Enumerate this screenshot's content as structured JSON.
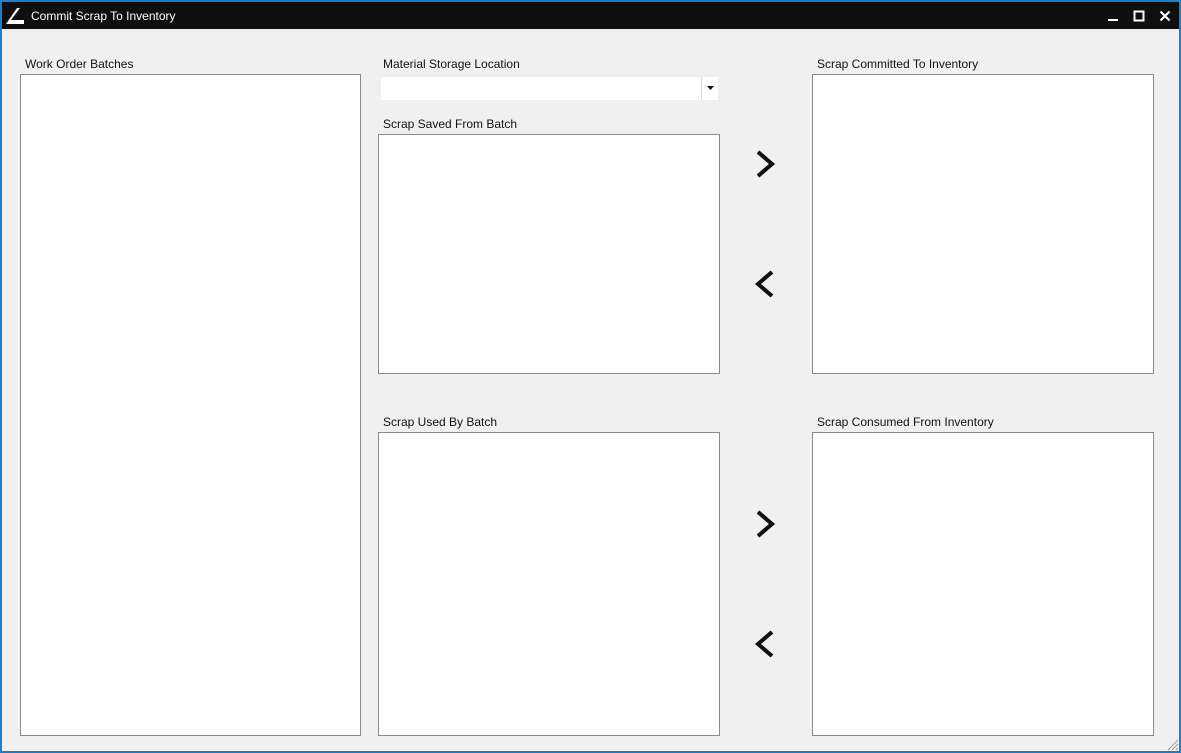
{
  "window": {
    "title": "Commit Scrap To Inventory",
    "accent_color": "#1e7fc9",
    "titlebar_color": "#0f0f0f",
    "controls": [
      "minimize-icon",
      "maximize-icon",
      "close-icon"
    ]
  },
  "panels": {
    "work_order_batches": {
      "label": "Work Order Batches",
      "items": []
    },
    "material_storage_location": {
      "label": "Material Storage Location",
      "selected": ""
    },
    "scrap_saved_from_batch": {
      "label": "Scrap Saved From Batch",
      "items": []
    },
    "scrap_committed_to_inventory": {
      "label": "Scrap Committed To Inventory",
      "items": []
    },
    "scrap_used_by_batch": {
      "label": "Scrap Used By Batch",
      "items": []
    },
    "scrap_consumed_from_inventory": {
      "label": "Scrap Consumed From Inventory",
      "items": []
    }
  },
  "buttons": {
    "commit_right": "chevron-right-icon",
    "commit_left": "chevron-left-icon",
    "consume_right": "chevron-right-icon",
    "consume_left": "chevron-left-icon"
  }
}
